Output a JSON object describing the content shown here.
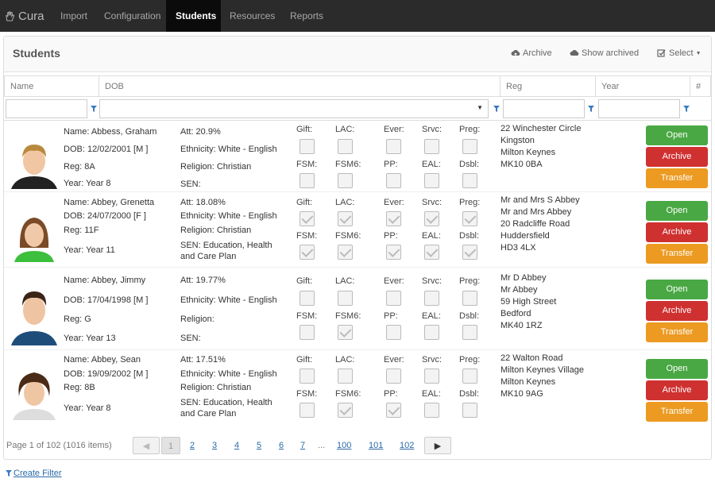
{
  "brand": "Cura",
  "nav": [
    "Import",
    "Configuration",
    "Students",
    "Resources",
    "Reports"
  ],
  "panel": {
    "title": "Students",
    "actions": {
      "archive": "Archive",
      "show_archived": "Show archived",
      "select": "Select"
    }
  },
  "columns": [
    "Name",
    "DOB",
    "Reg",
    "Year",
    "#"
  ],
  "flag_labels": {
    "gift": "Gift:",
    "lac": "LAC:",
    "ever": "Ever:",
    "srvc": "Srvc:",
    "preg": "Preg:",
    "fsm": "FSM:",
    "fsm6": "FSM6:",
    "pp": "PP:",
    "eal": "EAL:",
    "dsbl": "Dsbl:"
  },
  "buttons": {
    "open": "Open",
    "archive": "Archive",
    "transfer": "Transfer"
  },
  "students": [
    {
      "name": "Name: Abbess, Graham",
      "dob": "DOB: 12/02/2001 [M ]",
      "reg": "Reg: 8A",
      "year": "Year: Year 8",
      "att": "Att: 20.9%",
      "ethnicity": "Ethnicity: White - English",
      "religion": "Religion: Christian",
      "sen": "SEN:",
      "flags": {
        "gift": false,
        "lac": false,
        "ever": false,
        "srvc": false,
        "preg": false,
        "fsm": false,
        "fsm6": false,
        "pp": false,
        "eal": false,
        "dsbl": false
      },
      "address": [
        "22 Winchester Circle",
        "Kingston",
        "Milton Keynes",
        "MK10 0BA"
      ]
    },
    {
      "name": "Name: Abbey, Grenetta",
      "dob": "DOB: 24/07/2000 [F ]",
      "reg": "Reg: 11F",
      "year": "Year: Year 11",
      "att": "Att: 18.08%",
      "ethnicity": "Ethnicity: White - English",
      "religion": "Religion: Christian",
      "sen": "SEN: Education, Health and Care Plan",
      "flags": {
        "gift": true,
        "lac": true,
        "ever": true,
        "srvc": true,
        "preg": true,
        "fsm": true,
        "fsm6": true,
        "pp": true,
        "eal": true,
        "dsbl": true
      },
      "address": [
        "Mr and Mrs S Abbey",
        "Mr and Mrs Abbey",
        "20 Radcliffe Road",
        "Huddersfield",
        "HD3 4LX"
      ]
    },
    {
      "name": "Name: Abbey, Jimmy",
      "dob": "DOB: 17/04/1998 [M ]",
      "reg": "Reg: G",
      "year": "Year: Year 13",
      "att": "Att: 19.77%",
      "ethnicity": "Ethnicity: White - English",
      "religion": "Religion:",
      "sen": "SEN:",
      "flags": {
        "gift": false,
        "lac": false,
        "ever": false,
        "srvc": false,
        "preg": false,
        "fsm": false,
        "fsm6": true,
        "pp": false,
        "eal": false,
        "dsbl": false
      },
      "address": [
        "Mr D Abbey",
        "Mr Abbey",
        "59 High Street",
        "Bedford",
        "MK40 1RZ"
      ]
    },
    {
      "name": "Name: Abbey, Sean",
      "dob": "DOB: 19/09/2002 [M ]",
      "reg": "Reg: 8B",
      "year": "Year: Year 8",
      "att": "Att: 17.51%",
      "ethnicity": "Ethnicity: White - English",
      "religion": "Religion: Christian",
      "sen": "SEN: Education, Health and Care Plan",
      "flags": {
        "gift": false,
        "lac": false,
        "ever": false,
        "srvc": false,
        "preg": false,
        "fsm": false,
        "fsm6": true,
        "pp": true,
        "eal": false,
        "dsbl": false
      },
      "address": [
        "22 Walton Road",
        "Milton Keynes Village",
        "Milton Keynes",
        "MK10 9AG"
      ]
    }
  ],
  "pagination": {
    "info": "Page 1 of 102 (1016 items)",
    "pages": [
      "1",
      "2",
      "3",
      "4",
      "5",
      "6",
      "7",
      "...",
      "100",
      "101",
      "102"
    ]
  },
  "create_filter": "Create Filter",
  "colors": {
    "open": "#49a843",
    "archive": "#cf3131",
    "transfer": "#ec9a21",
    "nav_bg": "#2b2b2b"
  }
}
